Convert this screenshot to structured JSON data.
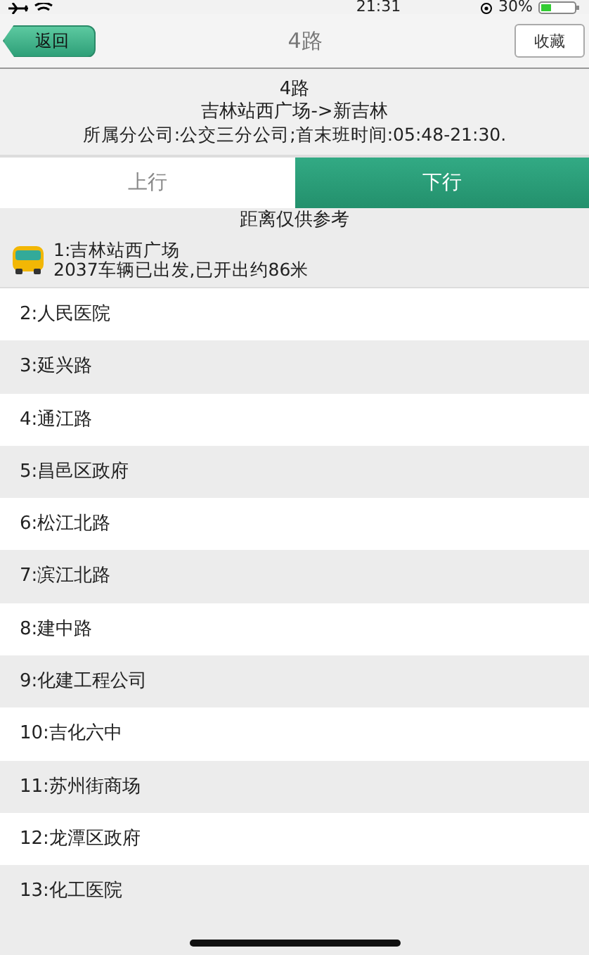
{
  "status_bar": {
    "time": "21:31",
    "battery": "30%"
  },
  "nav": {
    "back": "返回",
    "title": "4路",
    "favorite": "收藏"
  },
  "route": {
    "name": "4路",
    "direction": "吉林站西广场->新吉林",
    "info": "所属分公司:公交三分公司;首末班时间:05:48-21:30."
  },
  "tabs": [
    {
      "label": "上行",
      "selected": false
    },
    {
      "label": "下行",
      "selected": true
    }
  ],
  "note": "距离仅供参考",
  "bus": {
    "stop": "1:吉林站西广场",
    "status": "2037车辆已出发,已开出约86米"
  },
  "stops": [
    "2:人民医院",
    "3:延兴路",
    "4:通江路",
    "5:昌邑区政府",
    "6:松江北路",
    "7:滨江北路",
    "8:建中路",
    "9:化建工程公司",
    "10:吉化六中",
    "11:苏州街商场",
    "12:龙潭区政府",
    "13:化工医院"
  ]
}
